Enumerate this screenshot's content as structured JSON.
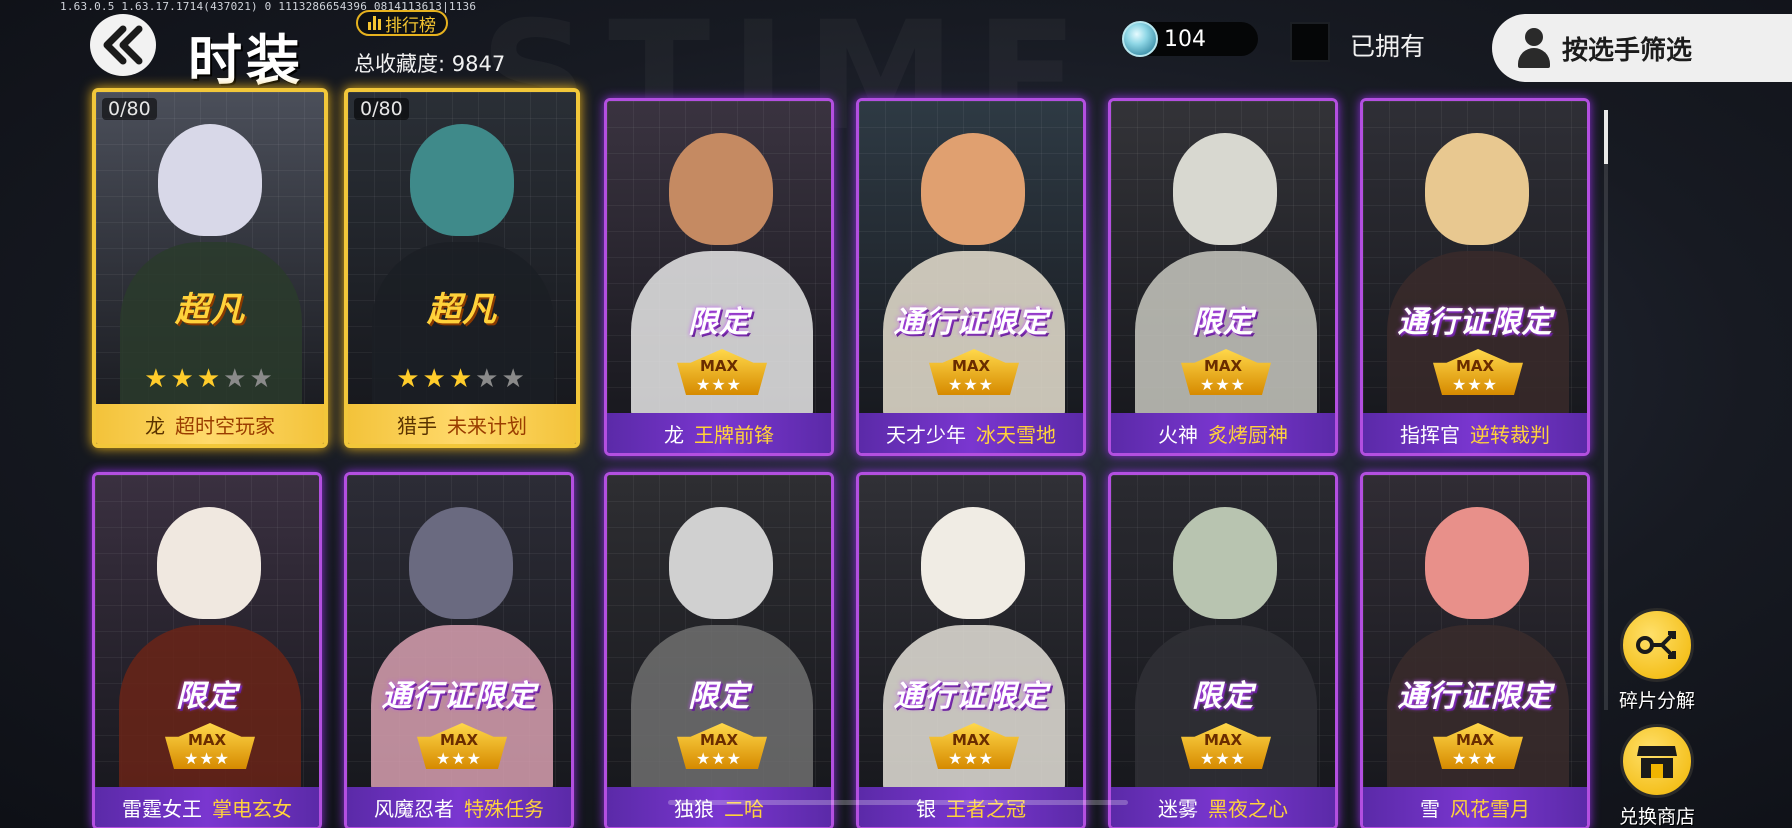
{
  "debug_text": "1.63.0.5 1.63.17.1714(437021) 0 1113286654396 0814113613|1136",
  "background_word": "STIME",
  "header": {
    "title": "时装",
    "rank_label": "排行榜",
    "collection_label": "总收藏度: 9847",
    "currency_value": "104",
    "owned_label": "已拥有",
    "filter_label": "按选手筛选"
  },
  "cards": [
    {
      "style": "gold",
      "counter": "0/80",
      "tag": "超凡",
      "stars_on": 3,
      "stars_total": 5,
      "who": "龙",
      "skin": "超时空玩家",
      "palette": [
        "#4b4f5a",
        "#d8d8e8",
        "#2a3b2b"
      ]
    },
    {
      "style": "gold",
      "counter": "0/80",
      "tag": "超凡",
      "stars_on": 3,
      "stars_total": 5,
      "who": "猎手",
      "skin": "未来计划",
      "palette": [
        "#2a2f36",
        "#3f8a8a",
        "#1b1f24"
      ]
    },
    {
      "style": "purple",
      "tag": "限定",
      "max": "MAX",
      "who": "龙",
      "skin": "王牌前锋",
      "palette": [
        "#3a3340",
        "#c58a62",
        "#e8e8e8"
      ]
    },
    {
      "style": "purple",
      "tag": "通行证限定",
      "max": "MAX",
      "who": "天才少年",
      "skin": "冰天雪地",
      "palette": [
        "#2e3a44",
        "#e0a070",
        "#e8e0d0"
      ]
    },
    {
      "style": "purple",
      "tag": "限定",
      "max": "MAX",
      "who": "火神",
      "skin": "炙烤厨神",
      "palette": [
        "#333338",
        "#d8d8d0",
        "#c8c8c0"
      ]
    },
    {
      "style": "purple",
      "tag": "通行证限定",
      "max": "MAX",
      "who": "指挥官",
      "skin": "逆转裁判",
      "palette": [
        "#2f2f36",
        "#e8c890",
        "#3a2a2a"
      ]
    },
    {
      "style": "purple",
      "tag": "限定",
      "max": "MAX",
      "who": "雷霆女王",
      "skin": "掌电玄女",
      "palette": [
        "#3a3040",
        "#f0e8e0",
        "#6a2418"
      ]
    },
    {
      "style": "purple",
      "tag": "通行证限定",
      "max": "MAX",
      "who": "风魔忍者",
      "skin": "特殊任务",
      "palette": [
        "#2c2c36",
        "#6a6a80",
        "#d8a0b0"
      ]
    },
    {
      "style": "purple",
      "tag": "限定",
      "max": "MAX",
      "who": "独狼",
      "skin": "二哈",
      "palette": [
        "#2e2e32",
        "#d0d0d0",
        "#707070"
      ]
    },
    {
      "style": "purple",
      "tag": "通行证限定",
      "max": "MAX",
      "who": "银",
      "skin": "王者之冠",
      "palette": [
        "#303036",
        "#f0ece4",
        "#e4e0d8"
      ]
    },
    {
      "style": "purple",
      "tag": "限定",
      "max": "MAX",
      "who": "迷雾",
      "skin": "黑夜之心",
      "palette": [
        "#2a2a30",
        "#b8c4b0",
        "#303036"
      ]
    },
    {
      "style": "purple",
      "tag": "通行证限定",
      "max": "MAX",
      "who": "雪",
      "skin": "风花雪月",
      "palette": [
        "#302c34",
        "#e8908a",
        "#3a2c2c"
      ]
    }
  ],
  "side_buttons": [
    {
      "label": "碎片分解",
      "icon": "split-icon"
    },
    {
      "label": "兑换商店",
      "icon": "shop-icon"
    }
  ],
  "colors": {
    "gold": "#f2c73a",
    "purple": "#b34fe0",
    "accent_yellow": "#ffd23b"
  }
}
